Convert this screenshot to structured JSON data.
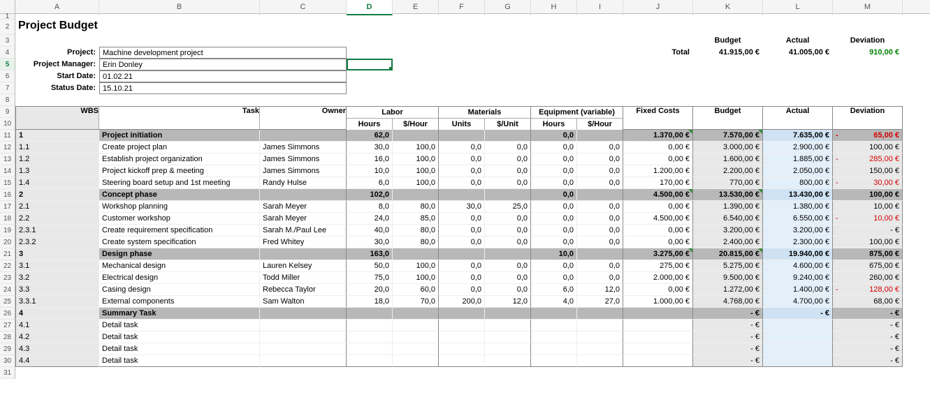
{
  "columns": [
    "A",
    "B",
    "C",
    "D",
    "E",
    "F",
    "G",
    "H",
    "I",
    "J",
    "K",
    "L",
    "M"
  ],
  "row_numbers": [
    1,
    2,
    3,
    4,
    5,
    6,
    7,
    8,
    9,
    10,
    11,
    12,
    13,
    14,
    15,
    16,
    17,
    18,
    19,
    20,
    21,
    22,
    23,
    24,
    25,
    26,
    27,
    28,
    29,
    30,
    31
  ],
  "active_cell": "D5",
  "title": "Project Budget",
  "meta_labels": {
    "project": "Project:",
    "pm": "Project Manager:",
    "start": "Start Date:",
    "status": "Status Date:"
  },
  "meta": {
    "project": "Machine development project",
    "pm": "Erin Donley",
    "start": "01.02.21",
    "status": "15.10.21"
  },
  "totals_labels": {
    "total": "Total",
    "budget": "Budget",
    "actual": "Actual",
    "deviation": "Deviation"
  },
  "totals": {
    "budget": "41.915,00 €",
    "actual": "41.005,00 €",
    "deviation": "910,00 €"
  },
  "group_headers": {
    "labor": "Labor",
    "materials": "Materials",
    "equipment": "Equipment (variable)"
  },
  "col_headers": {
    "wbs": "WBS",
    "task": "Task",
    "owner": "Owner",
    "hours": "Hours",
    "phour": "$/Hour",
    "units": "Units",
    "punit": "$/Unit",
    "hours2": "Hours",
    "phour2": "$/Hour",
    "fixed": "Fixed Costs",
    "budget": "Budget",
    "actual": "Actual",
    "dev": "Deviation"
  },
  "chart_data": {
    "type": "table",
    "rows": [
      {
        "wbs": "1",
        "task": "Project initiation",
        "owner": "",
        "lh": "62,0",
        "lr": "",
        "mu": "",
        "mp": "",
        "eh": "0,0",
        "er": "",
        "fixed": "1.370,00 €",
        "budget": "7.570,00 €",
        "actual": "7.635,00 €",
        "devSign": "-",
        "dev": "65,00 €",
        "devNeg": true,
        "summary": true
      },
      {
        "wbs": "1.1",
        "task": "Create project plan",
        "owner": "James Simmons",
        "lh": "30,0",
        "lr": "100,0",
        "mu": "0,0",
        "mp": "0,0",
        "eh": "0,0",
        "er": "0,0",
        "fixed": "0,00 €",
        "budget": "3.000,00 €",
        "actual": "2.900,00 €",
        "devSign": " ",
        "dev": "100,00 €",
        "devNeg": false
      },
      {
        "wbs": "1.2",
        "task": "Establish project organization",
        "owner": "James Simmons",
        "lh": "16,0",
        "lr": "100,0",
        "mu": "0,0",
        "mp": "0,0",
        "eh": "0,0",
        "er": "0,0",
        "fixed": "0,00 €",
        "budget": "1.600,00 €",
        "actual": "1.885,00 €",
        "devSign": "-",
        "dev": "285,00 €",
        "devNeg": true
      },
      {
        "wbs": "1.3",
        "task": "Project kickoff prep & meeting",
        "owner": "James Simmons",
        "lh": "10,0",
        "lr": "100,0",
        "mu": "0,0",
        "mp": "0,0",
        "eh": "0,0",
        "er": "0,0",
        "fixed": "1.200,00 €",
        "budget": "2.200,00 €",
        "actual": "2.050,00 €",
        "devSign": " ",
        "dev": "150,00 €",
        "devNeg": false
      },
      {
        "wbs": "1.4",
        "task": "Steering board setup and 1st meeting",
        "owner": "Randy Hulse",
        "lh": "6,0",
        "lr": "100,0",
        "mu": "0,0",
        "mp": "0,0",
        "eh": "0,0",
        "er": "0,0",
        "fixed": "170,00 €",
        "budget": "770,00 €",
        "actual": "800,00 €",
        "devSign": "-",
        "dev": "30,00 €",
        "devNeg": true
      },
      {
        "wbs": "2",
        "task": "Concept phase",
        "owner": "",
        "lh": "102,0",
        "lr": "",
        "mu": "",
        "mp": "",
        "eh": "0,0",
        "er": "",
        "fixed": "4.500,00 €",
        "budget": "13.530,00 €",
        "actual": "13.430,00 €",
        "devSign": " ",
        "dev": "100,00 €",
        "devNeg": false,
        "summary": true
      },
      {
        "wbs": "2.1",
        "task": "Workshop planning",
        "owner": "Sarah Meyer",
        "lh": "8,0",
        "lr": "80,0",
        "mu": "30,0",
        "mp": "25,0",
        "eh": "0,0",
        "er": "0,0",
        "fixed": "0,00 €",
        "budget": "1.390,00 €",
        "actual": "1.380,00 €",
        "devSign": " ",
        "dev": "10,00 €",
        "devNeg": false
      },
      {
        "wbs": "2.2",
        "task": "Customer workshop",
        "owner": "Sarah Meyer",
        "lh": "24,0",
        "lr": "85,0",
        "mu": "0,0",
        "mp": "0,0",
        "eh": "0,0",
        "er": "0,0",
        "fixed": "4.500,00 €",
        "budget": "6.540,00 €",
        "actual": "6.550,00 €",
        "devSign": "-",
        "dev": "10,00 €",
        "devNeg": true
      },
      {
        "wbs": "2.3.1",
        "task": "Create requirement specification",
        "owner": "Sarah M./Paul Lee",
        "lh": "40,0",
        "lr": "80,0",
        "mu": "0,0",
        "mp": "0,0",
        "eh": "0,0",
        "er": "0,0",
        "fixed": "0,00 €",
        "budget": "3.200,00 €",
        "actual": "3.200,00 €",
        "devSign": " ",
        "dev": "-   €",
        "devNeg": false
      },
      {
        "wbs": "2.3.2",
        "task": "Create system specification",
        "owner": "Fred Whitey",
        "lh": "30,0",
        "lr": "80,0",
        "mu": "0,0",
        "mp": "0,0",
        "eh": "0,0",
        "er": "0,0",
        "fixed": "0,00 €",
        "budget": "2.400,00 €",
        "actual": "2.300,00 €",
        "devSign": " ",
        "dev": "100,00 €",
        "devNeg": false
      },
      {
        "wbs": "3",
        "task": "Design phase",
        "owner": "",
        "lh": "163,0",
        "lr": "",
        "mu": "",
        "mp": "",
        "eh": "10,0",
        "er": "",
        "fixed": "3.275,00 €",
        "budget": "20.815,00 €",
        "actual": "19.940,00 €",
        "devSign": " ",
        "dev": "875,00 €",
        "devNeg": false,
        "summary": true
      },
      {
        "wbs": "3.1",
        "task": "Mechanical design",
        "owner": "Lauren Kelsey",
        "lh": "50,0",
        "lr": "100,0",
        "mu": "0,0",
        "mp": "0,0",
        "eh": "0,0",
        "er": "0,0",
        "fixed": "275,00 €",
        "budget": "5.275,00 €",
        "actual": "4.600,00 €",
        "devSign": " ",
        "dev": "675,00 €",
        "devNeg": false
      },
      {
        "wbs": "3.2",
        "task": "Electrical design",
        "owner": "Todd Miller",
        "lh": "75,0",
        "lr": "100,0",
        "mu": "0,0",
        "mp": "0,0",
        "eh": "0,0",
        "er": "0,0",
        "fixed": "2.000,00 €",
        "budget": "9.500,00 €",
        "actual": "9.240,00 €",
        "devSign": " ",
        "dev": "260,00 €",
        "devNeg": false
      },
      {
        "wbs": "3.3",
        "task": "Casing design",
        "owner": "Rebecca Taylor",
        "lh": "20,0",
        "lr": "60,0",
        "mu": "0,0",
        "mp": "0,0",
        "eh": "6,0",
        "er": "12,0",
        "fixed": "0,00 €",
        "budget": "1.272,00 €",
        "actual": "1.400,00 €",
        "devSign": "-",
        "dev": "128,00 €",
        "devNeg": true
      },
      {
        "wbs": "3.3.1",
        "task": "External components",
        "owner": "Sam Walton",
        "lh": "18,0",
        "lr": "70,0",
        "mu": "200,0",
        "mp": "12,0",
        "eh": "4,0",
        "er": "27,0",
        "fixed": "1.000,00 €",
        "budget": "4.768,00 €",
        "actual": "4.700,00 €",
        "devSign": " ",
        "dev": "68,00 €",
        "devNeg": false
      },
      {
        "wbs": "4",
        "task": "Summary Task",
        "owner": "",
        "lh": "",
        "lr": "",
        "mu": "",
        "mp": "",
        "eh": "",
        "er": "",
        "fixed": "",
        "budget": "-   €",
        "actual": "-   €",
        "devSign": " ",
        "dev": "-   €",
        "devNeg": false,
        "summary": true
      },
      {
        "wbs": "4.1",
        "task": "Detail task",
        "owner": "",
        "lh": "",
        "lr": "",
        "mu": "",
        "mp": "",
        "eh": "",
        "er": "",
        "fixed": "",
        "budget": "-   €",
        "actual": "",
        "devSign": " ",
        "dev": "-   €",
        "devNeg": false
      },
      {
        "wbs": "4.2",
        "task": "Detail task",
        "owner": "",
        "lh": "",
        "lr": "",
        "mu": "",
        "mp": "",
        "eh": "",
        "er": "",
        "fixed": "",
        "budget": "-   €",
        "actual": "",
        "devSign": " ",
        "dev": "-   €",
        "devNeg": false
      },
      {
        "wbs": "4.3",
        "task": "Detail task",
        "owner": "",
        "lh": "",
        "lr": "",
        "mu": "",
        "mp": "",
        "eh": "",
        "er": "",
        "fixed": "",
        "budget": "-   €",
        "actual": "",
        "devSign": " ",
        "dev": "-   €",
        "devNeg": false
      },
      {
        "wbs": "4.4",
        "task": "Detail task",
        "owner": "",
        "lh": "",
        "lr": "",
        "mu": "",
        "mp": "",
        "eh": "",
        "er": "",
        "fixed": "",
        "budget": "-   €",
        "actual": "",
        "devSign": " ",
        "dev": "-   €",
        "devNeg": false
      }
    ]
  }
}
